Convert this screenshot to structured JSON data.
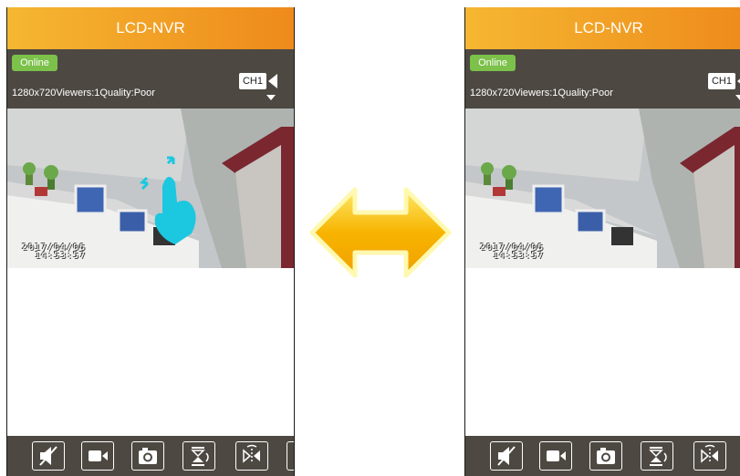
{
  "screens": {
    "left": {
      "title": "LCD-NVR",
      "status": "Online",
      "info": "1280x720Viewers:1Quality:Poor",
      "channel": "CH1",
      "timestamp_date": "2017/04/06",
      "timestamp_time": "14:53:57"
    },
    "right": {
      "title": "LCD-NVR",
      "status": "Online",
      "info": "1280x720Viewers:1Quality:Poor",
      "channel": "CH1",
      "timestamp_date": "2017/04/06",
      "timestamp_time": "14:53:57"
    }
  },
  "toolbar_icons": [
    "mute-icon",
    "record-icon",
    "snapshot-icon",
    "flip-vertical-icon",
    "mirror-horizontal-icon"
  ],
  "colors": {
    "header_start": "#f5b731",
    "header_end": "#ee8a1b",
    "bar": "#4d4842",
    "online": "#7cc14a",
    "gesture": "#1cc7e0",
    "swap_arrow": "#f7b500"
  }
}
